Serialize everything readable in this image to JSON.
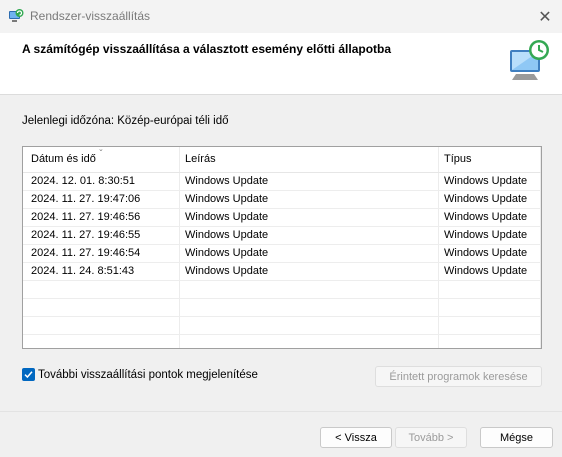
{
  "window": {
    "title": "Rendszer-visszaállítás",
    "close_glyph": "✕"
  },
  "header": {
    "title": "A számítógép visszaállítása a választott esemény előtti állapotba"
  },
  "timezone": "Jelenlegi időzóna: Közép-európai téli idő",
  "table": {
    "columns": [
      "Dátum és idő",
      "Leírás",
      "Típus"
    ],
    "sort_indicator": "⌄",
    "rows": [
      [
        "2024. 12. 01. 8:30:51",
        "Windows Update",
        "Windows Update"
      ],
      [
        "2024. 11. 27. 19:47:06",
        "Windows Update",
        "Windows Update"
      ],
      [
        "2024. 11. 27. 19:46:56",
        "Windows Update",
        "Windows Update"
      ],
      [
        "2024. 11. 27. 19:46:55",
        "Windows Update",
        "Windows Update"
      ],
      [
        "2024. 11. 27. 19:46:54",
        "Windows Update",
        "Windows Update"
      ],
      [
        "2024. 11. 24. 8:51:43",
        "Windows Update",
        "Windows Update"
      ]
    ]
  },
  "show_more": {
    "label": "További visszaállítási pontok megjelenítése",
    "checked": true
  },
  "buttons": {
    "scan": "Érintett programok keresése",
    "back": "< Vissza",
    "next": "Tovább >",
    "cancel": "Mégse"
  },
  "colors": {
    "accent": "#0067c0"
  }
}
